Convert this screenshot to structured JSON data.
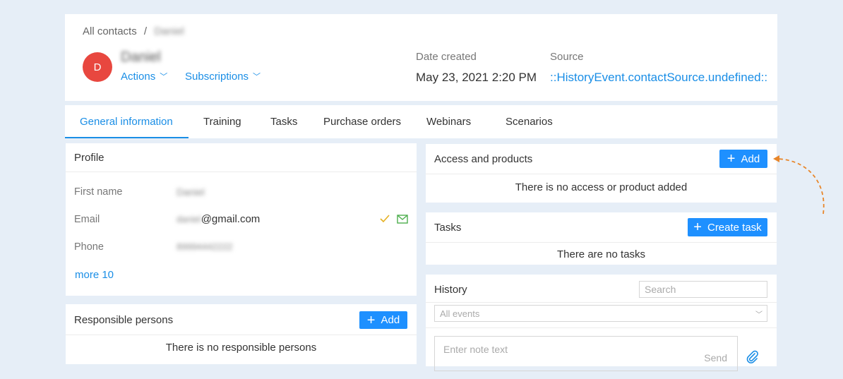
{
  "header": {
    "breadcrumb_root": "All contacts",
    "breadcrumb_sep": "/",
    "breadcrumb_current": "Daniel",
    "avatar_letter": "D",
    "avatar_color": "#e8473f",
    "contact_name": "Daniel",
    "actions_label": "Actions",
    "subscriptions_label": "Subscriptions",
    "date_created_label": "Date created",
    "date_created_value": "May 23, 2021 2:20 PM",
    "source_label": "Source",
    "source_value": "::HistoryEvent.contactSource.undefined::"
  },
  "tabs": [
    {
      "label": "General information",
      "active": true
    },
    {
      "label": "Training"
    },
    {
      "label": "Tasks"
    },
    {
      "label": "Purchase orders"
    },
    {
      "label": "Webinars"
    },
    {
      "label": "Scenarios"
    }
  ],
  "profile": {
    "title": "Profile",
    "first_name_label": "First name",
    "first_name_value": "Daniel",
    "email_label": "Email",
    "email_prefix": "daniel",
    "email_domain": "@gmail.com",
    "phone_label": "Phone",
    "phone_value": "89994442222",
    "more_label": "more 10"
  },
  "responsible": {
    "title": "Responsible persons",
    "add_label": "Add",
    "empty_text": "There is no responsible persons"
  },
  "access": {
    "title": "Access and products",
    "add_label": "Add",
    "empty_text": "There is no access or product added"
  },
  "tasks": {
    "title": "Tasks",
    "create_label": "Create task",
    "empty_text": "There are no tasks"
  },
  "history": {
    "title": "History",
    "search_placeholder": "Search",
    "filter_value": "All events",
    "note_placeholder": "Enter note text",
    "send_label": "Send"
  },
  "colors": {
    "accent": "#1e90ff",
    "annotation_arrow": "#e8862a",
    "verified_check": "#e5b020",
    "mail_icon": "#4cae4c"
  }
}
